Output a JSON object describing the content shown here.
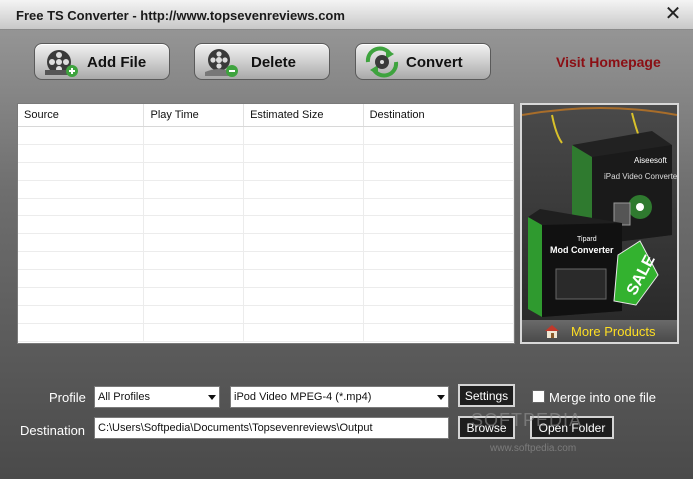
{
  "window": {
    "title": "Free TS Converter - http://www.topsevenreviews.com",
    "close_glyph": "✕"
  },
  "toolbar": {
    "add_file_label": "Add File",
    "delete_label": "Delete",
    "convert_label": "Convert",
    "add_file_icon": "film-reel-add-icon",
    "delete_icon": "film-reel-delete-icon",
    "convert_icon": "convert-arrows-icon"
  },
  "visit_homepage_label": "Visit Homepage",
  "file_list": {
    "columns": [
      "Source",
      "Play Time",
      "Estimated Size",
      "Destination"
    ],
    "rows": []
  },
  "promo": {
    "box1_brand": "Aiseesoft",
    "box1_product": "iPad Video Converter",
    "box2_brand": "Tipard",
    "box2_product": "Mod Converter",
    "sale_tag": "SALE",
    "more_products_label": "More Products"
  },
  "settings": {
    "profile_label": "Profile",
    "profile_category": "All Profiles",
    "profile_format": "iPod Video MPEG-4 (*.mp4)",
    "settings_button": "Settings",
    "merge_label": "Merge into one file",
    "merge_checked": false,
    "destination_label": "Destination",
    "destination_path": "C:\\Users\\Softpedia\\Documents\\Topsevenreviews\\Output",
    "browse_button": "Browse",
    "open_folder_button": "Open Folder"
  },
  "watermark": {
    "brand": "SOFTPEDIA",
    "url": "www.softpedia.com"
  },
  "colors": {
    "accent_link": "#8b0f14",
    "more_products": "#ffdf22"
  }
}
